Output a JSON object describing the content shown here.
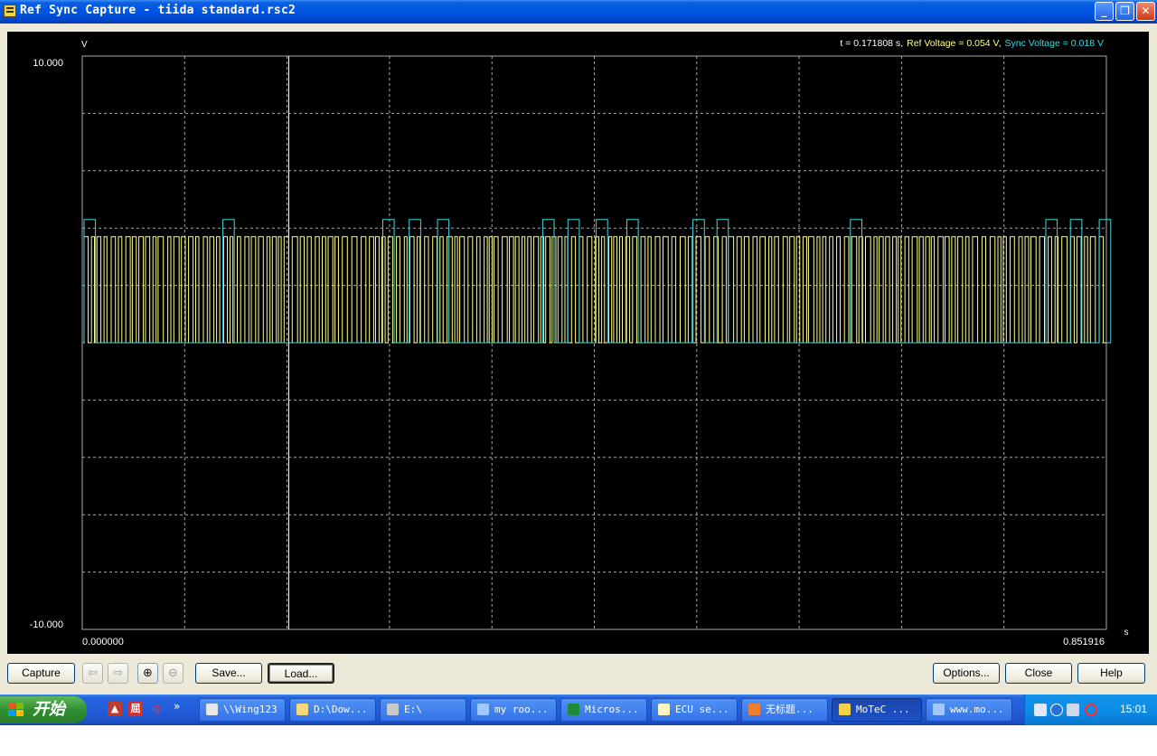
{
  "window": {
    "title": "Ref Sync Capture - tiida standard.rsc2",
    "controls": {
      "minimize": "_",
      "maximize": "❐",
      "close": "✕"
    }
  },
  "plot": {
    "y_unit": "V",
    "x_unit": "s",
    "y_max_label": "10.000",
    "y_min_label": "-10.000",
    "x_min_label": "0.000000",
    "x_max_label": "0.851916",
    "readout": {
      "time": "t = 0.171808 s",
      "separator": ",",
      "ref": "Ref Voltage =  0.054 V",
      "sync": "Sync Voltage =  0.018 V"
    },
    "colors": {
      "ref": "#ffff88",
      "sync": "#40d8e0",
      "grid": "#a8a8a8",
      "cursor": "#ffffff",
      "background": "#000000"
    }
  },
  "chart_data": {
    "type": "line",
    "title": "",
    "xlabel": "s",
    "ylabel": "V",
    "xlim": [
      0.0,
      0.851916
    ],
    "ylim": [
      -10.0,
      10.0
    ],
    "grid": true,
    "cursor_x": 0.171808,
    "series": [
      {
        "name": "Ref Voltage",
        "color": "#ffff88",
        "low": 0.0,
        "high": 3.7,
        "description": "dense square pulse train"
      },
      {
        "name": "Sync Voltage",
        "color": "#40d8e0",
        "low": 0.0,
        "high": 4.3,
        "pulse_groups_x": [
          0.0,
          0.1155,
          0.2485,
          0.2705,
          0.294,
          0.3815,
          0.4025,
          0.426,
          0.4515,
          0.5065,
          0.5265,
          0.6375,
          0.8,
          0.8205,
          0.8445
        ],
        "pulse_width": 0.0095
      }
    ]
  },
  "buttons": {
    "capture": "Capture",
    "back": "⇦",
    "forward": "⇨",
    "zoom_in": "⊕",
    "zoom_out": "⊖",
    "save": "Save...",
    "load": "Load...",
    "options": "Options...",
    "close": "Close",
    "help": "Help"
  },
  "taskbar": {
    "start": "开始",
    "more": "»",
    "tasks": [
      {
        "label": "\\\\Wing123",
        "active": false
      },
      {
        "label": "D:\\Dow...",
        "active": false
      },
      {
        "label": "E:\\",
        "active": false
      },
      {
        "label": "my roo...",
        "active": false
      },
      {
        "label": "Micros...",
        "active": false
      },
      {
        "label": "ECU se...",
        "active": false
      },
      {
        "label": "无标题...",
        "active": false
      },
      {
        "label": "MoTeC ...",
        "active": true
      },
      {
        "label": "www.mo...",
        "active": false
      }
    ],
    "clock": "15:01"
  }
}
